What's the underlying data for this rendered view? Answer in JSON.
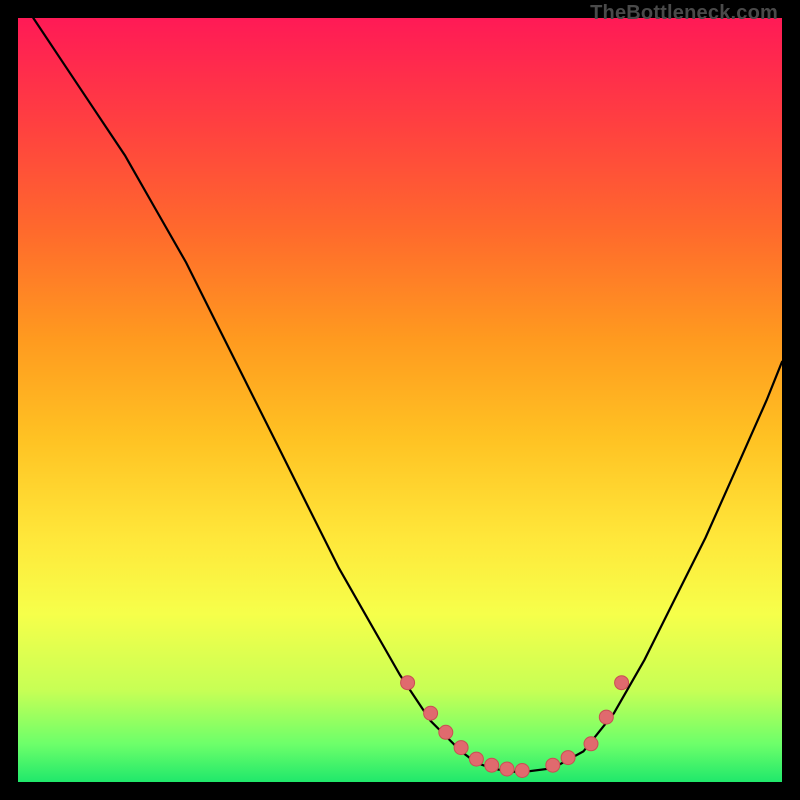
{
  "watermark": "TheBottleneck.com",
  "colors": {
    "curve_stroke": "#000000",
    "marker_fill": "#e06a6e",
    "marker_stroke": "#c94f53"
  },
  "chart_data": {
    "type": "line",
    "title": "",
    "xlabel": "",
    "ylabel": "",
    "xlim": [
      0,
      100
    ],
    "ylim": [
      0,
      100
    ],
    "series": [
      {
        "name": "curve",
        "x": [
          2,
          6,
          10,
          14,
          18,
          22,
          26,
          30,
          34,
          38,
          42,
          46,
          50,
          54,
          58,
          60,
          62,
          64,
          66,
          70,
          74,
          78,
          82,
          86,
          90,
          94,
          98,
          100
        ],
        "values": [
          100,
          94,
          88,
          82,
          75,
          68,
          60,
          52,
          44,
          36,
          28,
          21,
          14,
          8,
          4,
          2.5,
          1.8,
          1.4,
          1.3,
          1.8,
          4,
          9,
          16,
          24,
          32,
          41,
          50,
          55
        ]
      }
    ],
    "markers": {
      "name": "marker-cluster",
      "x": [
        51,
        54,
        56,
        58,
        60,
        62,
        64,
        66,
        70,
        72,
        75,
        77,
        79
      ],
      "values": [
        13,
        9,
        6.5,
        4.5,
        3,
        2.2,
        1.7,
        1.5,
        2.2,
        3.2,
        5,
        8.5,
        13
      ]
    }
  }
}
